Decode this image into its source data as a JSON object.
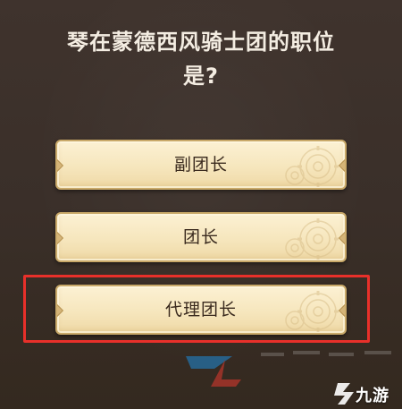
{
  "question": {
    "line1": "琴在蒙德西风骑士团的职位",
    "line2": "是?"
  },
  "options": [
    {
      "label": "副团长"
    },
    {
      "label": "团长"
    },
    {
      "label": "代理团长"
    }
  ],
  "highlight": {
    "selected_option_index": 2,
    "color": "#e8302a"
  },
  "watermark": {
    "logo_icon": "jiuyou-logo-icon",
    "text": "九游",
    "accent_colors": [
      "#1f8bd8",
      "#e23a2f"
    ]
  }
}
